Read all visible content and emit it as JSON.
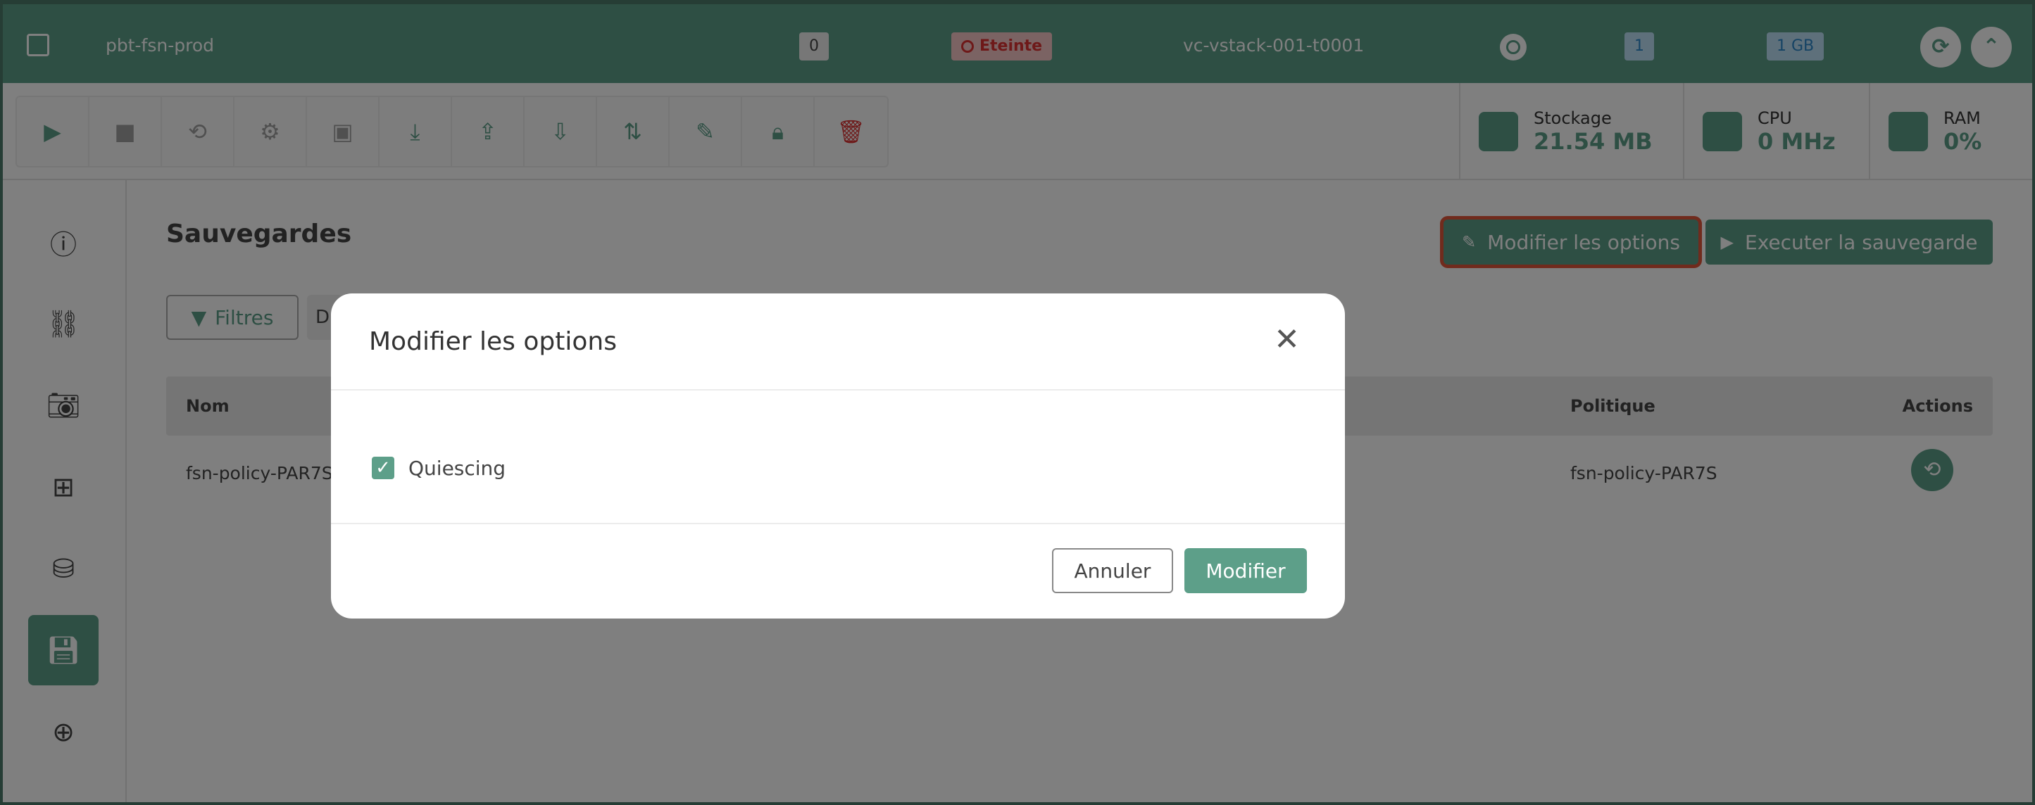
{
  "vm": {
    "name": "pbt-fsn-prod",
    "count": "0",
    "state": "Eteinte",
    "host": "vc-vstack-001-t0001",
    "cpu_count": "1",
    "memory": "1 GB"
  },
  "toolbar_icons": [
    "play-icon",
    "stop-icon",
    "restart-icon",
    "settings-icon",
    "console-icon",
    "import-icon",
    "upload-icon",
    "download-icon",
    "migrate-icon",
    "edit-icon",
    "lock-icon",
    "delete-icon"
  ],
  "stats": {
    "storage": {
      "label": "Stockage",
      "value": "21.54 MB"
    },
    "cpu": {
      "label": "CPU",
      "value": "0 MHz"
    },
    "ram": {
      "label": "RAM",
      "value": "0%"
    }
  },
  "page": {
    "title": "Sauvegardes",
    "modify_options_label": "Modifier les options",
    "run_backup_label": "Executer la sauvegarde",
    "filters_label": "Filtres",
    "chip_text": "D"
  },
  "table": {
    "headers": {
      "name": "Nom",
      "policy": "Politique",
      "actions": "Actions"
    },
    "rows": [
      {
        "name": "fsn-policy-PAR7S.",
        "policy": "fsn-policy-PAR7S"
      }
    ]
  },
  "modal": {
    "title": "Modifier les options",
    "option_label": "Quiescing",
    "option_checked": true,
    "cancel_label": "Annuler",
    "submit_label": "Modifier"
  },
  "colors": {
    "accent": "#5d9f89",
    "danger": "#dd3333",
    "highlight": "#e1573a"
  }
}
